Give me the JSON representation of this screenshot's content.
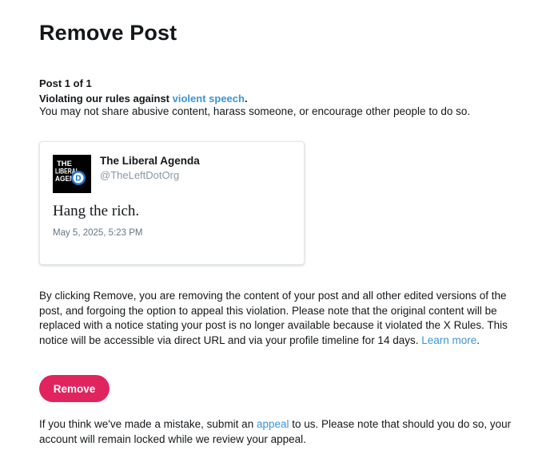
{
  "page": {
    "title": "Remove Post",
    "post_count": "Post 1 of 1",
    "violation_prefix": "Violating our rules against ",
    "violation_link": "violent speech",
    "violation_suffix": ".",
    "rule_description": "You may not share abusive content, harass someone, or encourage other people to do so."
  },
  "post": {
    "avatar_text": [
      "THE",
      "LIBERAL",
      "AGEN"
    ],
    "avatar_logo_letter": "D",
    "display_name": "The Liberal Agenda",
    "handle": "@TheLeftDotOrg",
    "text": "Hang the rich.",
    "timestamp": "May 5, 2025, 5:23 PM"
  },
  "explanation": {
    "text": "By clicking Remove, you are removing the content of your post and all other edited versions of the post, and forgoing the option to appeal this violation. Please note that the original content will be replaced with a notice stating your post is no longer available because it violated the X Rules. This notice will be accessible via direct URL and via your profile timeline for 14 days. ",
    "learn_more": "Learn more",
    "suffix": "."
  },
  "actions": {
    "remove_label": "Remove"
  },
  "appeal": {
    "prefix": "If you think we've made a mistake, submit an ",
    "link": "appeal",
    "suffix": " to us. Please note that should you do so, your account will remain locked while we review your appeal."
  },
  "colors": {
    "link": "#3b94d9",
    "remove_button": "#e0245e",
    "muted": "#657786"
  }
}
